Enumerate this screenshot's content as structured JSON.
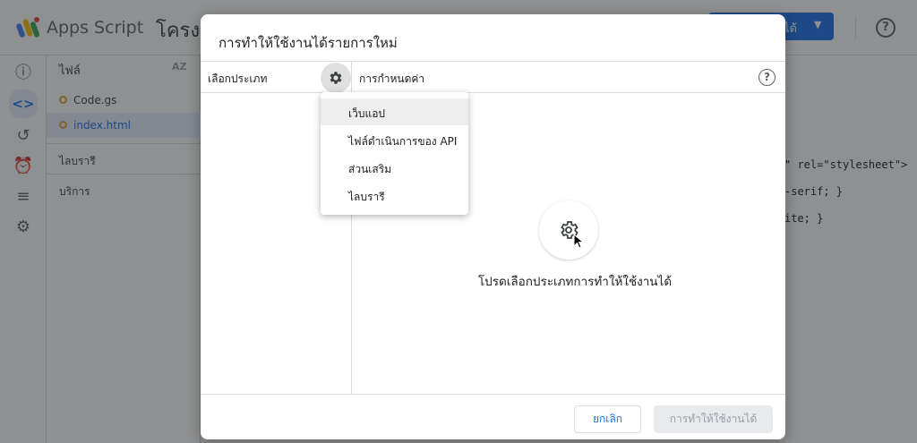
{
  "app": {
    "name": "Apps Script",
    "project_title": "โครงก",
    "deploy_button_label": "ได้",
    "colors": {
      "accent": "#1a73e8",
      "file_dot": "#e8a33c"
    }
  },
  "files_panel": {
    "header": "ไฟล์",
    "sort_label": "AZ",
    "files": [
      {
        "name": "Code.gs",
        "selected": false
      },
      {
        "name": "index.html",
        "selected": true
      }
    ],
    "sections": [
      "ไลบรารี",
      "บริการ"
    ]
  },
  "rail_icons": [
    "info-icon",
    "code-icon",
    "history-icon",
    "alarm-icon",
    "executions-icon",
    "settings-icon"
  ],
  "editor": {
    "lines": [
      {
        "text": "\" rel=\"stylesheet\">"
      },
      {
        "text": "-serif; }"
      },
      {
        "text": "ite; }"
      }
    ]
  },
  "dialog": {
    "title": "การทำให้ใช้งานได้รายการใหม่",
    "select_type_label": "เลือกประเภท",
    "configuration_label": "การกำหนดค่า",
    "empty_message": "โปรดเลือกประเภทการทำให้ใช้งานได้",
    "cancel_label": "ยกเลิก",
    "deploy_label": "การทำให้ใช้งานได้"
  },
  "type_menu": {
    "items": [
      {
        "label": "เว็บแอป",
        "highlighted": true
      },
      {
        "label": "ไฟล์ดำเนินการของ API",
        "highlighted": false
      },
      {
        "label": "ส่วนเสริม",
        "highlighted": false
      },
      {
        "label": "ไลบรารี",
        "highlighted": false
      }
    ]
  }
}
